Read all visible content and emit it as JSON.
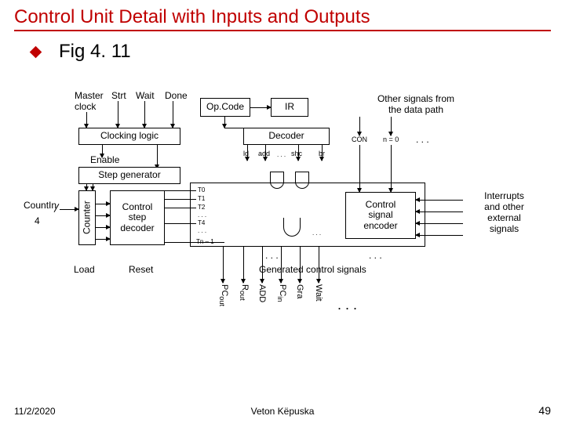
{
  "title": "Control Unit Detail with Inputs and Outputs",
  "fig": "Fig 4. 11",
  "top_labels": {
    "master_clock": "Master\nclock",
    "strt": "Strt",
    "wait": "Wait",
    "done": "Done"
  },
  "boxes": {
    "opcode": "Op.Code",
    "ir": "IR",
    "other_signals": "Other signals from\nthe data path",
    "clocking": "Clocking logic",
    "enable": "Enable",
    "stepgen": "Step generator",
    "decoder": "Decoder",
    "counter": "Counter",
    "ctrl_step_decoder": "Control\nstep\ndecoder",
    "ctrl_sig_encoder": "Control\nsignal\nencoder",
    "interrupts": "Interrupts\nand other\nexternal\nsignals"
  },
  "dec_out": {
    "ld": "ld",
    "add": "add",
    "dots": ". . .",
    "shc": "shc",
    "br": "br"
  },
  "cond": {
    "con": "CON",
    "neq0": "n = 0",
    "dots": ". . ."
  },
  "t_labels": {
    "t0": "T0",
    "t1": "T1",
    "t2": "T2",
    "d1": ". . .",
    "t4": "T4",
    "d2": ". . .",
    "tnm1": "Tn – 1"
  },
  "left": {
    "countin": "CountIn",
    "four": "4"
  },
  "below": {
    "load": "Load",
    "reset": "Reset"
  },
  "gen_sig": "Generated control signals",
  "signals": [
    "PC",
    "R",
    "ADD",
    "PC",
    "Gra",
    "Wait",
    ". . ."
  ],
  "sub": [
    "out",
    "out",
    "",
    "in",
    "",
    ""
  ],
  "footer": {
    "date": "11/2/2020",
    "author": "Veton Këpuska",
    "page": "49"
  },
  "dots": ". . ."
}
